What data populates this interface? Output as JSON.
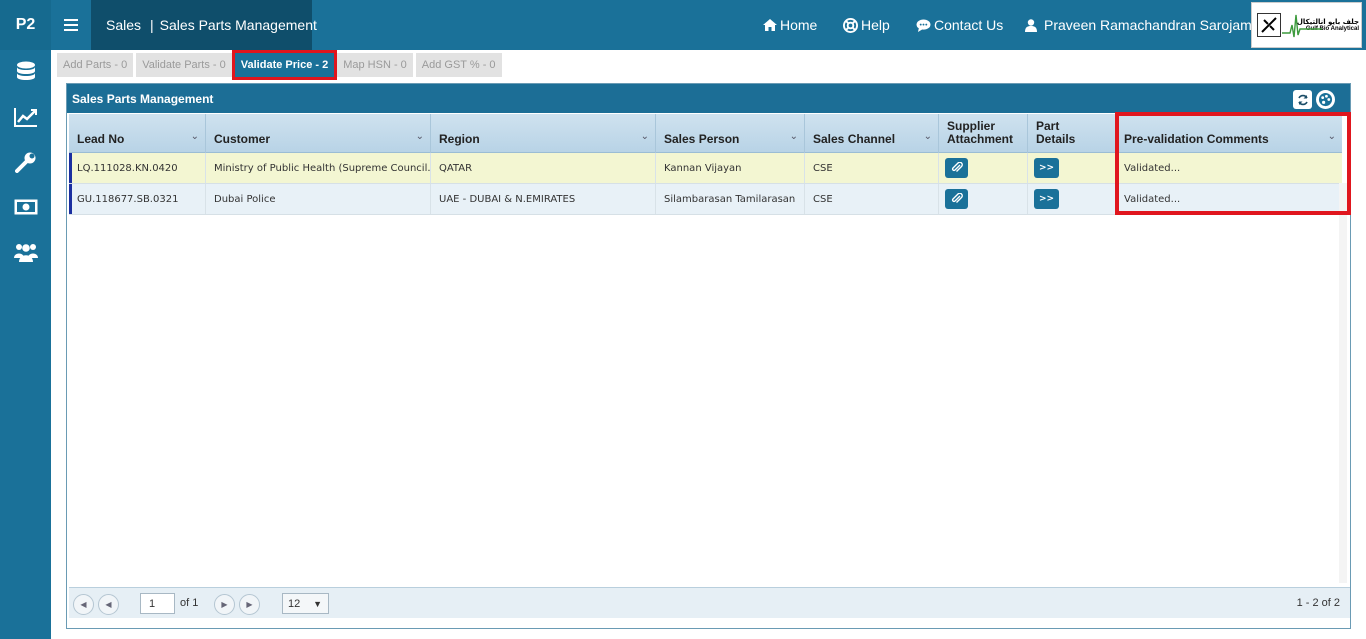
{
  "app": {
    "brand": "P2",
    "breadcrumb_module": "Sales",
    "breadcrumb_sep": "|",
    "breadcrumb_page": "Sales Parts Management"
  },
  "nav": {
    "home": "Home",
    "help": "Help",
    "contact": "Contact Us",
    "user": "Praveen Ramachandran Sarojam"
  },
  "logo": {
    "arabic": "جلف بايو انالتيكال",
    "english": "Gulf Bio Analytical"
  },
  "sidebar": {
    "icons": [
      "database-icon",
      "line-chart-icon",
      "wrench-icon",
      "money-icon",
      "users-icon"
    ]
  },
  "tabs": [
    {
      "label": "Add Parts - 0",
      "active": false
    },
    {
      "label": "Validate Parts - 0",
      "active": false
    },
    {
      "label": "Validate Price - 2",
      "active": true
    },
    {
      "label": "Map HSN - 0",
      "active": false
    },
    {
      "label": "Add GST % - 0",
      "active": false
    }
  ],
  "panel": {
    "title": "Sales Parts Management"
  },
  "grid": {
    "columns": [
      {
        "key": "lead_no",
        "label": "Lead No",
        "filter": true
      },
      {
        "key": "customer",
        "label": "Customer",
        "filter": true
      },
      {
        "key": "region",
        "label": "Region",
        "filter": true
      },
      {
        "key": "sales_person",
        "label": "Sales Person",
        "filter": true
      },
      {
        "key": "sales_channel",
        "label": "Sales Channel",
        "filter": true
      },
      {
        "key": "supplier_attachment",
        "label": "Supplier Attachment",
        "filter": false
      },
      {
        "key": "part_details",
        "label": "Part Details",
        "filter": false
      },
      {
        "key": "prevalidation",
        "label": "Pre-validation Comments",
        "filter": true
      }
    ],
    "col_label_1": "Supplier",
    "col_label_2": "Attachment",
    "col_label_3": "Part",
    "col_label_4": "Details",
    "rows": [
      {
        "lead_no": "LQ.111028.KN.0420",
        "customer": "Ministry of Public Health (Supreme Council...",
        "region": "QATAR",
        "sales_person": "Kannan Vijayan",
        "sales_channel": "CSE",
        "part_details_btn": ">>",
        "prevalidation": "Validated..."
      },
      {
        "lead_no": "GU.118677.SB.0321",
        "customer": "Dubai Police",
        "region": "UAE - DUBAI & N.EMIRATES",
        "sales_person": "Silambarasan Tamilarasan",
        "sales_channel": "CSE",
        "part_details_btn": ">>",
        "prevalidation": "Validated..."
      }
    ]
  },
  "pager": {
    "page": "1",
    "of_label": "of 1",
    "page_size": "12",
    "info": "1 - 2 of 2"
  },
  "colors": {
    "primary": "#1a7199",
    "highlight": "#e0161e",
    "row_selected": "#f3f6d2",
    "row_alt": "#e8f1f7"
  }
}
